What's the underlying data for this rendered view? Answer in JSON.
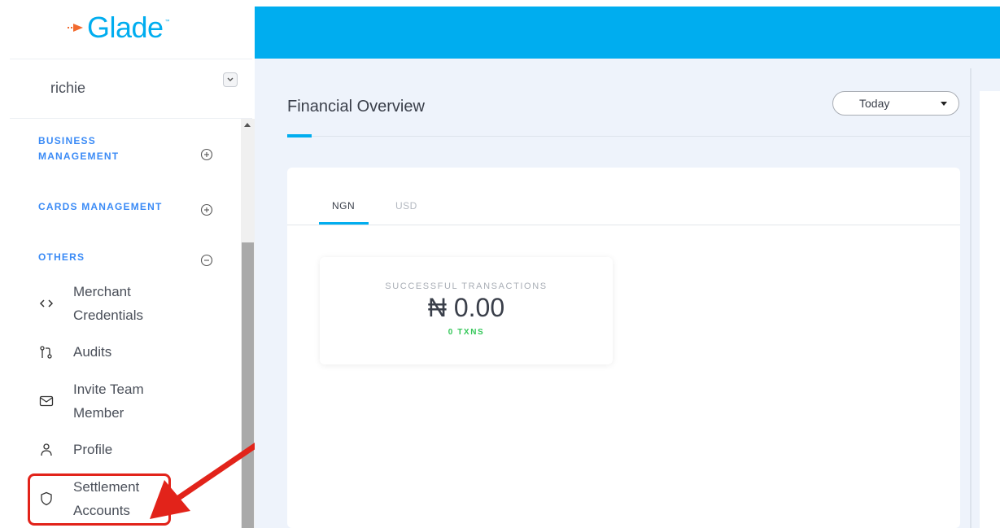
{
  "brand": {
    "logo_text": "Glade",
    "accent": "#00adef",
    "logo_arrow_color": "#f26a2e"
  },
  "user": {
    "name": "richie"
  },
  "sidebar": {
    "sections": [
      {
        "label": "BUSINESS MANAGEMENT",
        "line1": "BUSINESS",
        "line2": "MANAGEMENT",
        "state": "collapsed"
      },
      {
        "label": "CARDS MANAGEMENT",
        "state": "collapsed"
      },
      {
        "label": "OTHERS",
        "state": "expanded"
      }
    ],
    "items": [
      {
        "line1": "Merchant",
        "line2": "Credentials",
        "icon": "code-icon"
      },
      {
        "line1": "Audits",
        "line2": "",
        "icon": "git-pull-request-icon"
      },
      {
        "line1": "Invite Team",
        "line2": "Member",
        "icon": "mail-icon"
      },
      {
        "line1": "Profile",
        "line2": "",
        "icon": "user-icon"
      },
      {
        "line1": "Settlement",
        "line2": "Accounts",
        "icon": "shield-icon"
      }
    ]
  },
  "main": {
    "title": "Financial Overview",
    "period": {
      "selected": "Today"
    },
    "tabs": [
      {
        "label": "NGN",
        "active": true
      },
      {
        "label": "USD",
        "active": false
      }
    ],
    "stat": {
      "label": "SUCCESSFUL TRANSACTIONS",
      "value": "₦ 0.00",
      "count": "0 TXNS"
    }
  },
  "annotation": {
    "color": "#e2231a"
  }
}
